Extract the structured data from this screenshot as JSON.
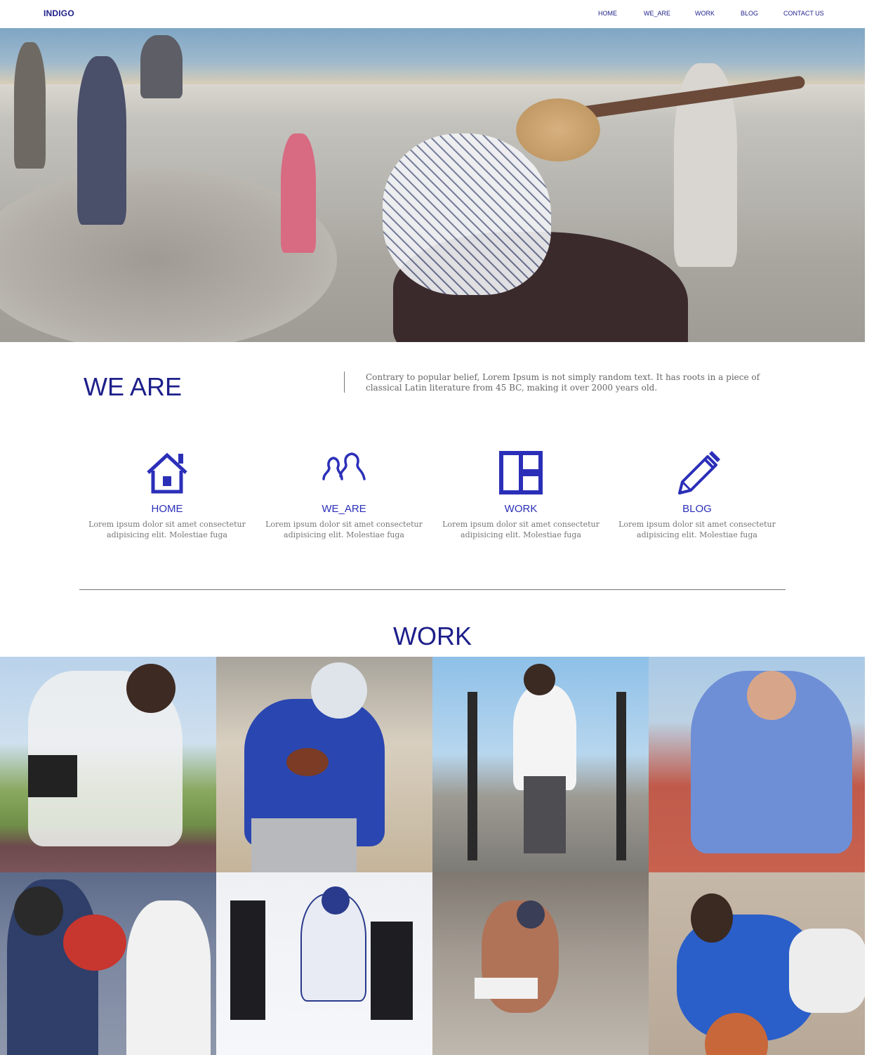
{
  "nav": {
    "brand": "INDIGO",
    "links": [
      "HOME",
      "WE_ARE",
      "WORK",
      "BLOG",
      "CONTACT US"
    ]
  },
  "hero": {
    "image": "skateboarder-skatepark-photo"
  },
  "weare": {
    "title": "WE ARE",
    "text": "Contrary to popular belief, Lorem Ipsum is not simply random text. It has roots in a piece of classical Latin literature from 45 BC, making it over 2000 years old."
  },
  "features": [
    {
      "icon": "home-icon",
      "title": "HOME",
      "desc": "Lorem ipsum dolor sit amet consectetur adipisicing elit. Molestiae fuga"
    },
    {
      "icon": "users-icon",
      "title": "WE_ARE",
      "desc": "Lorem ipsum dolor sit amet consectetur adipisicing elit. Molestiae fuga"
    },
    {
      "icon": "layout-icon",
      "title": "WORK",
      "desc": "Lorem ipsum dolor sit amet consectetur adipisicing elit. Molestiae fuga"
    },
    {
      "icon": "pencil-icon",
      "title": "BLOG",
      "desc": "Lorem ipsum dolor sit amet consectetur adipisicing elit. Molestiae fuga"
    }
  ],
  "work": {
    "title": "WORK",
    "tiles": [
      "sprinter-start-photo",
      "football-quarterback-photo",
      "sled-push-photo",
      "track-start-photo",
      "boxing-photo",
      "hockey-photo",
      "skateboard-bowl-photo",
      "basketball-dive-photo"
    ]
  },
  "colors": {
    "accent": "#1d1f8a",
    "icon_blue": "#2b2fb8",
    "text_gray": "#666666"
  }
}
